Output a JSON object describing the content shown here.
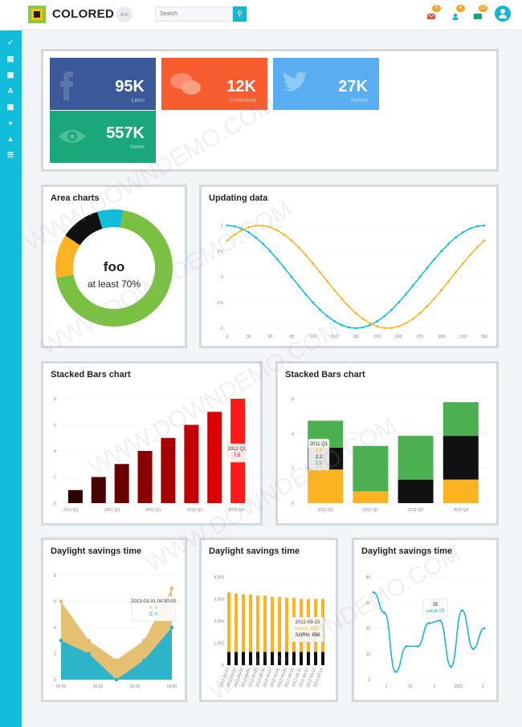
{
  "app": {
    "brand": "COLORED",
    "collapse_label": "<<"
  },
  "search": {
    "placeholder": "Search"
  },
  "notifications": {
    "messages": "5",
    "users": "4",
    "tasks": "12"
  },
  "sidebar": {
    "icons": [
      "home-icon",
      "users-icon",
      "check-icon",
      "file-icon",
      "chart-icon",
      "font-icon",
      "calendar-icon",
      "map-marker-icon",
      "warning-icon",
      "list-icon"
    ]
  },
  "tiles": [
    {
      "value": "95K",
      "label": "Likes",
      "color": "#3b5998",
      "icon": "facebook-icon"
    },
    {
      "value": "12K",
      "label": "Comments",
      "color": "#f75c2e",
      "icon": "comment-icon"
    },
    {
      "value": "27K",
      "label": "Tweets",
      "color": "#58aef0",
      "icon": "twitter-icon"
    },
    {
      "value": "557K",
      "label": "Views",
      "color": "#1aa77c",
      "icon": "eye-icon"
    }
  ],
  "area_panel": {
    "title": "Area charts",
    "center_title": "foo",
    "center_sub": "at least 70%"
  },
  "updating_panel": {
    "title": "Updating data"
  },
  "stacked1_panel": {
    "title": "Stacked Bars chart"
  },
  "stacked2_panel": {
    "title": "Stacked Bars chart"
  },
  "dst1_panel": {
    "title": "Daylight savings time"
  },
  "dst2_panel": {
    "title": "Daylight savings time"
  },
  "dst3_panel": {
    "title": "Daylight savings time"
  },
  "watermark": "WWW.DOWNDEMO.COM",
  "chart_data": [
    {
      "type": "pie",
      "title": "Area charts",
      "slices": [
        {
          "value": 70,
          "color": "#7ac143"
        },
        {
          "value": 12,
          "color": "#fbb321"
        },
        {
          "value": 11,
          "color": "#111111"
        },
        {
          "value": 7,
          "color": "#12bcdb"
        }
      ]
    },
    {
      "type": "line",
      "title": "Updating data",
      "x_ticks": [
        "0",
        "30",
        "60",
        "90",
        "120",
        "150",
        "180",
        "210",
        "240",
        "270",
        "300",
        "330",
        "360"
      ],
      "y_ticks": [
        "1",
        "0.5",
        "0",
        "-0.5",
        "-1"
      ],
      "ylim": [
        -1,
        1
      ],
      "series": [
        {
          "color": "#12bcdb",
          "fn": "cos"
        },
        {
          "color": "#fbb321",
          "fn": "sin"
        }
      ]
    },
    {
      "type": "bar",
      "title": "Stacked Bars chart",
      "categories": [
        "2011 Q1",
        "2011 Q2",
        "2011 Q3",
        "2011 Q4",
        "2012 Q1",
        "2012 Q2",
        "2012 Q3",
        "2012 Q4"
      ],
      "x_ticks": [
        "2011 Q1",
        "2011 Q3",
        "2012 Q1",
        "2012 Q3",
        "2012 Q4"
      ],
      "values": [
        1,
        2,
        3,
        4,
        5,
        6,
        7,
        8
      ],
      "ylim": [
        0,
        8
      ],
      "y_ticks": [
        "8",
        "6",
        "4",
        "2",
        "0"
      ],
      "tooltip": {
        "title": "2012 Q1",
        "value": "7.5"
      }
    },
    {
      "type": "bar",
      "title": "Stacked Bars chart",
      "categories": [
        "2011 Q1",
        "2011 Q2",
        "2011 Q3",
        "2011 Q4"
      ],
      "series": [
        {
          "color": "#fbb321",
          "values": [
            2,
            0.7,
            0,
            1.4
          ]
        },
        {
          "color": "#111111",
          "values": [
            1.3,
            0,
            1.4,
            2.6
          ]
        },
        {
          "color": "#4caf50",
          "values": [
            1.6,
            2.7,
            2.6,
            2
          ]
        }
      ],
      "ylim": [
        0,
        8
      ],
      "y_ticks": [
        "8",
        "4",
        "2",
        "0"
      ],
      "tooltip": {
        "title": "2011 Q1",
        "lines": [
          "1.9",
          "2.2",
          "1.5"
        ]
      }
    },
    {
      "type": "area",
      "title": "Daylight savings time",
      "x_ticks": [
        "02:00",
        "00:00",
        "02:00",
        "04:00"
      ],
      "y_ticks": [
        "8",
        "6",
        "4",
        "2",
        "0"
      ],
      "ylim": [
        0,
        8
      ],
      "series": [
        {
          "color": "#e2b863",
          "values": [
            6,
            3,
            1.5,
            3,
            7
          ]
        },
        {
          "color": "#1ab3d2",
          "values": [
            3,
            2,
            0,
            1.5,
            4
          ]
        }
      ],
      "tooltip": {
        "title": "2013-03-31 04:00:00",
        "lines": [
          "Y: 8",
          "Z: 4"
        ]
      }
    },
    {
      "type": "bar",
      "title": "Daylight savings time",
      "y_ticks": [
        "4,000",
        "3,000",
        "2,000",
        "1,000",
        "0"
      ],
      "ylim": [
        0,
        4000
      ],
      "x_ticks": [
        "2012-09-01",
        "2012-09-02",
        "2012-09-03",
        "2012-09-04",
        "2012-09-05",
        "2012-09-06",
        "2012-09-07",
        "2012-09-08",
        "2012-09-09",
        "2012-09-10",
        "2012-09-11",
        "2012-09-12",
        "2012-09-13",
        "2012-09-14"
      ],
      "series": [
        {
          "color": "#fbb321",
          "values": [
            3300,
            3250,
            3200,
            3200,
            3150,
            3150,
            3100,
            3100,
            3050,
            3050,
            3000,
            3000,
            3000,
            3000
          ]
        },
        {
          "color": "#111111",
          "values": [
            600,
            600,
            600,
            600,
            600,
            600,
            600,
            600,
            600,
            600,
            600,
            600,
            600,
            600
          ]
        }
      ],
      "tooltip": {
        "title": "2012-09-15",
        "lines": [
          "series: 3257",
          "SORN: 656"
        ]
      }
    },
    {
      "type": "line",
      "title": "Daylight savings time",
      "y_ticks": [
        "40",
        "30",
        "20",
        "10",
        "0"
      ],
      "ylim": [
        0,
        40
      ],
      "x_ticks": [
        "1",
        "21",
        "1",
        "2022",
        "3"
      ],
      "series": [
        {
          "color": "#1ab3d2",
          "values": [
            34,
            26,
            3,
            13,
            13,
            22,
            23,
            5,
            27,
            12,
            20
          ]
        }
      ],
      "tooltip": {
        "title": "35",
        "lines": [
          "value 23"
        ]
      }
    }
  ]
}
